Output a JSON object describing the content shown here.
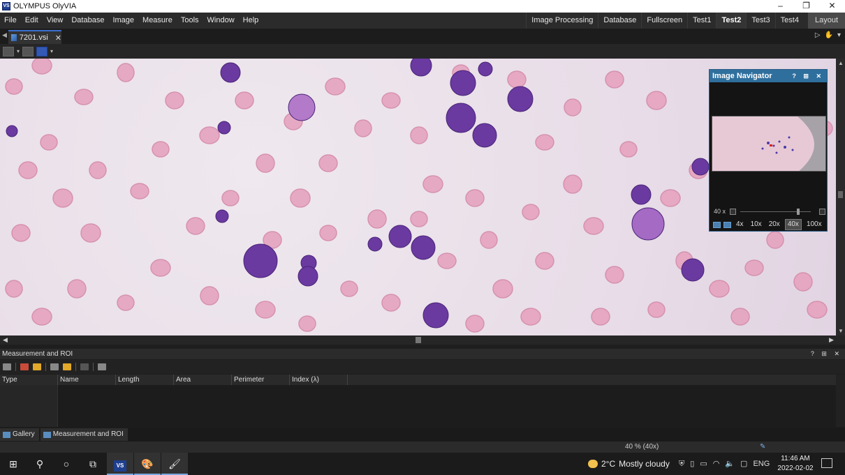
{
  "window": {
    "title": "OLYMPUS OlyVIA",
    "app_icon": "VS",
    "minimize": "–",
    "restore": "❐",
    "close": "✕"
  },
  "menu": {
    "items": [
      "File",
      "Edit",
      "View",
      "Database",
      "Image",
      "Measure",
      "Tools",
      "Window",
      "Help"
    ],
    "layouts": [
      {
        "label": "Image Processing",
        "active": false
      },
      {
        "label": "Database",
        "active": false
      },
      {
        "label": "Fullscreen",
        "active": false
      },
      {
        "label": "Test1",
        "active": false
      },
      {
        "label": "Test2",
        "active": true
      },
      {
        "label": "Test3",
        "active": false
      },
      {
        "label": "Test4",
        "active": false
      }
    ],
    "layout_dropdown": "Layout"
  },
  "document_tab": {
    "name": "7201.vsi",
    "close": "✕"
  },
  "navigator": {
    "title": "Image Navigator",
    "zoom_readout": "40 x",
    "objectives": [
      "4x",
      "10x",
      "20x",
      "40x",
      "100x"
    ],
    "selected_objective": "40x",
    "zoom_level": 0.83
  },
  "measurement_panel": {
    "title": "Measurement and ROI",
    "columns": [
      "Type",
      "Name",
      "Length",
      "Area",
      "Perimeter",
      "Index (λ)"
    ]
  },
  "bottom_tabs": [
    "Gallery",
    "Measurement and ROI"
  ],
  "statusbar": {
    "zoom": "40 % (40x)"
  },
  "taskbar": {
    "weather_temp": "2°C",
    "weather_text": "Mostly cloudy",
    "language": "ENG",
    "time": "11:46 AM",
    "date": "2022-02-02"
  },
  "colors": {
    "accent": "#2f6f9d",
    "rbc": "#e49bb8",
    "nucleus": "#5a2a8e",
    "background": "#e8dde8"
  }
}
